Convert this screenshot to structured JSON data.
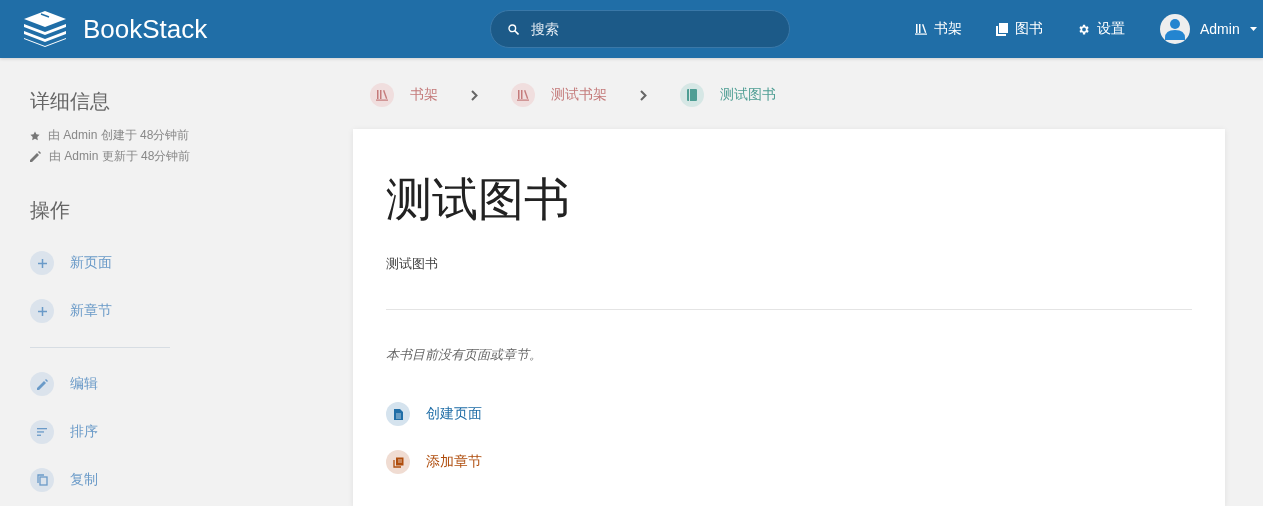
{
  "header": {
    "logo": "BookStack",
    "search": {
      "placeholder": "搜索"
    },
    "nav": [
      {
        "kind": "shelves",
        "label": "书架"
      },
      {
        "kind": "books",
        "label": "图书"
      },
      {
        "kind": "settings",
        "label": "设置"
      }
    ],
    "user": {
      "name": "Admin"
    }
  },
  "sidebar": {
    "details": {
      "title": "详细信息",
      "entries": [
        {
          "kind": "created",
          "text": "由 Admin 创建于 48分钟前"
        },
        {
          "kind": "updated",
          "text": "由 Admin 更新于 48分钟前"
        }
      ]
    },
    "actions": {
      "title": "操作",
      "groups": [
        [
          {
            "kind": "plus",
            "label": "新页面"
          },
          {
            "kind": "plus",
            "label": "新章节"
          }
        ],
        [
          {
            "kind": "edit",
            "label": "编辑"
          },
          {
            "kind": "sort",
            "label": "排序"
          },
          {
            "kind": "copy",
            "label": "复制"
          }
        ]
      ]
    }
  },
  "breadcrumbs": [
    {
      "kind": "shelves",
      "label": "书架"
    },
    {
      "kind": "shelf",
      "label": "测试书架"
    },
    {
      "kind": "book",
      "label": "测试图书"
    }
  ],
  "book": {
    "title": "测试图书",
    "description": "测试图书",
    "empty_message": "本书目前没有页面或章节。",
    "links": [
      {
        "kind": "page",
        "label": "创建页面"
      },
      {
        "kind": "chapter",
        "label": "添加章节"
      }
    ]
  }
}
